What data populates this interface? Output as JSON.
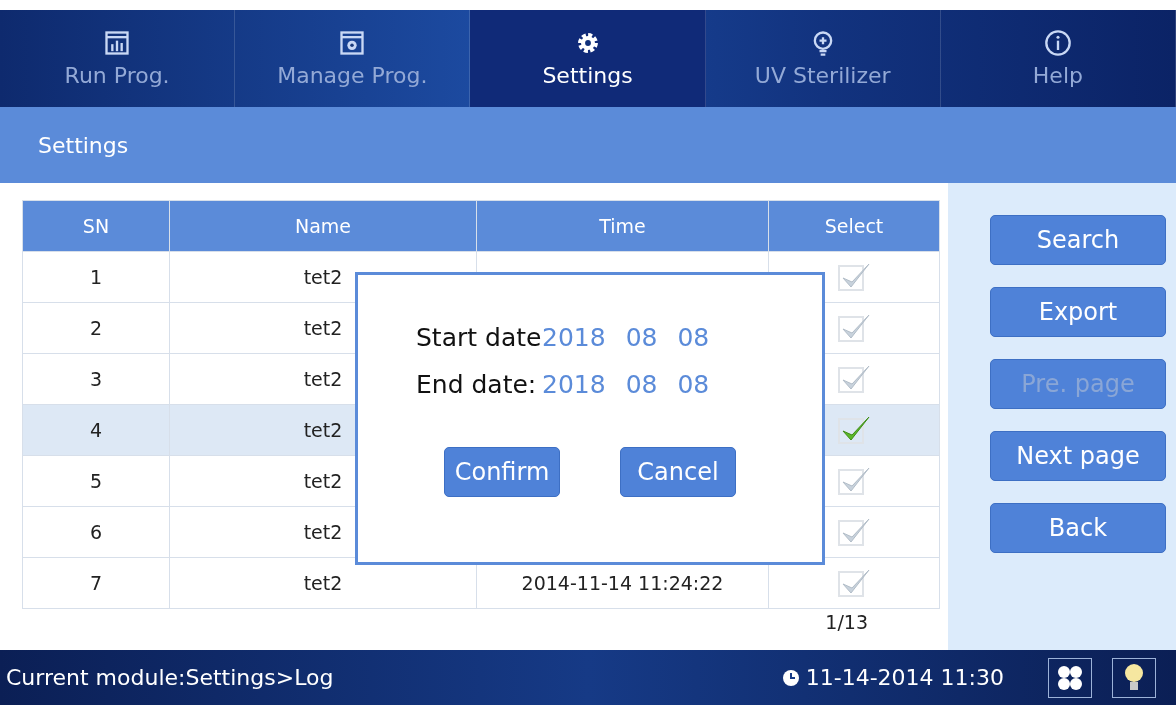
{
  "tabs": [
    {
      "label": "Run Prog.",
      "selected": false
    },
    {
      "label": "Manage Prog.",
      "selected": false
    },
    {
      "label": "Settings",
      "selected": true
    },
    {
      "label": "UV Sterilizer",
      "selected": false
    },
    {
      "label": "Help",
      "selected": false
    }
  ],
  "page_title": "Settings",
  "table": {
    "columns": [
      "SN",
      "Name",
      "Time",
      "Select"
    ],
    "rows": [
      {
        "sn": "1",
        "name": "tet2",
        "checked": false,
        "selected": false
      },
      {
        "sn": "2",
        "name": "tet2",
        "checked": false,
        "selected": false
      },
      {
        "sn": "3",
        "name": "tet2",
        "checked": false,
        "selected": false
      },
      {
        "sn": "4",
        "name": "tet2",
        "checked": true,
        "selected": true
      },
      {
        "sn": "5",
        "name": "tet2",
        "checked": false,
        "selected": false
      },
      {
        "sn": "6",
        "name": "tet2",
        "checked": false,
        "selected": false
      },
      {
        "sn": "7",
        "name": "tet2",
        "time": "2014-11-14   11:24:22",
        "checked": false,
        "selected": false
      }
    ]
  },
  "pagination": "1/13",
  "side_buttons": [
    {
      "label": "Search",
      "disabled": false
    },
    {
      "label": "Export",
      "disabled": false
    },
    {
      "label": "Pre. page",
      "disabled": true
    },
    {
      "label": "Next page",
      "disabled": false
    },
    {
      "label": "Back",
      "disabled": false
    }
  ],
  "dialog": {
    "fields": [
      {
        "label": "Start date",
        "year": "2018",
        "month": "08",
        "day": "08"
      },
      {
        "label": "End date:",
        "year": "2018",
        "month": "08",
        "day": "08"
      }
    ],
    "buttons": [
      "Confirm",
      "Cancel"
    ]
  },
  "status_bar": {
    "module": "Current module:Settings>Log",
    "datetime": "11-14-2014 11:30"
  }
}
